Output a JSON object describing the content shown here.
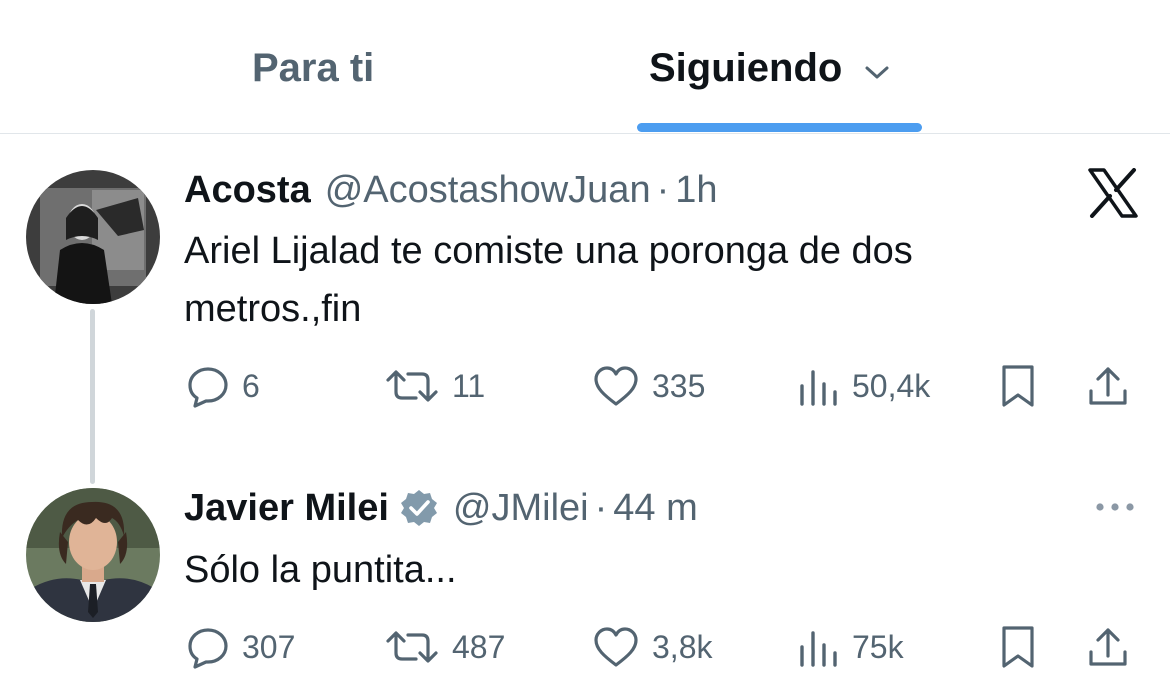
{
  "tabs": {
    "for_you": "Para ti",
    "following": "Siguiendo"
  },
  "colors": {
    "accent": "#4c9df0",
    "secondary_text": "#536471",
    "primary_text": "#0f1419",
    "verified": "#829aab"
  },
  "icons": [
    "chevron-down-icon",
    "x-logo-icon",
    "reply-icon",
    "retweet-icon",
    "like-icon",
    "views-icon",
    "bookmark-icon",
    "share-icon",
    "verified-badge-icon",
    "more-icon"
  ],
  "posts": [
    {
      "name": "Acosta",
      "handle": "@AcostashowJuan",
      "separator": "·",
      "time": "1h",
      "text": "Ariel Lijalad te comiste una poronga de dos metros.,fin",
      "replies": "6",
      "reposts": "11",
      "likes": "335",
      "views": "50,4k"
    },
    {
      "name": "Javier Milei",
      "verified": true,
      "handle": "@JMilei",
      "separator": "·",
      "time": "44 m",
      "text": "Sólo la puntita...",
      "replies": "307",
      "reposts": "487",
      "likes": "3,8k",
      "views": "75k"
    }
  ]
}
